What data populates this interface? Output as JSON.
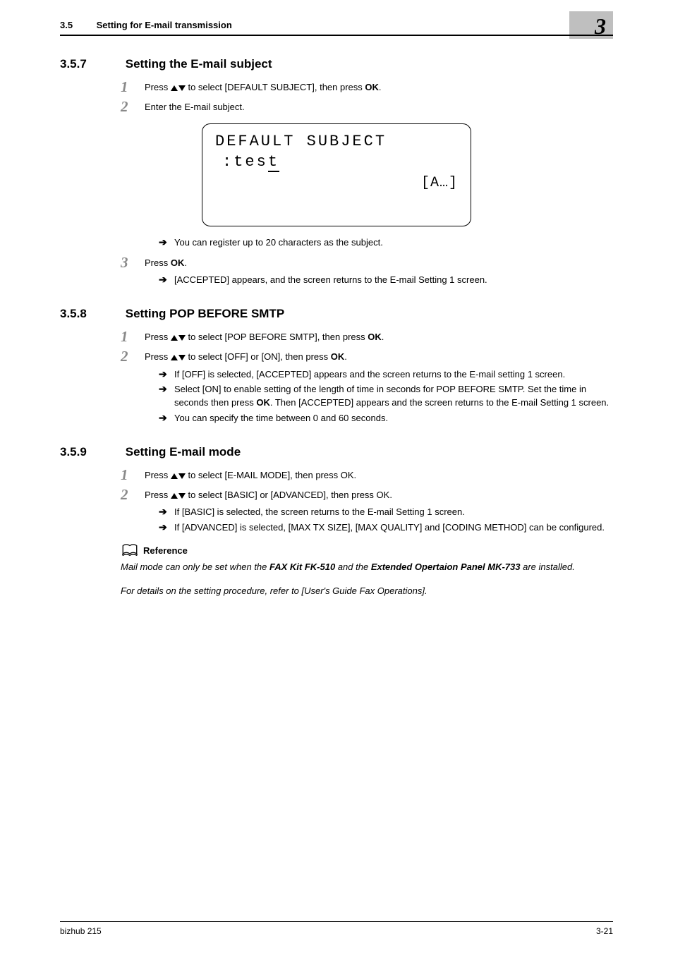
{
  "header": {
    "section_number": "3.5",
    "section_title": "Setting for E-mail transmission",
    "chapter_number": "3"
  },
  "sections": {
    "s357": {
      "num": "3.5.7",
      "title": "Setting the E-mail subject"
    },
    "s358": {
      "num": "3.5.8",
      "title": "Setting POP BEFORE SMTP"
    },
    "s359": {
      "num": "3.5.9",
      "title": "Setting E-mail mode"
    }
  },
  "steps": {
    "s357_1_pre": "Press ",
    "s357_1_post": " to select [DEFAULT SUBJECT], then press ",
    "s357_1_key": "OK",
    "s357_1_end": ".",
    "s357_2": "Enter the E-mail subject.",
    "s357_note1": "You can register up to 20 characters as the subject.",
    "s357_3_pre": "Press ",
    "s357_3_key": "OK",
    "s357_3_end": ".",
    "s357_note2": "[ACCEPTED] appears, and the screen returns to the E-mail Setting 1 screen.",
    "s358_1_pre": "Press ",
    "s358_1_post": " to select [POP BEFORE SMTP], then press ",
    "s358_1_key": "OK",
    "s358_1_end": ".",
    "s358_2_pre": "Press ",
    "s358_2_post": " to select [OFF] or [ON], then press ",
    "s358_2_key": "OK",
    "s358_2_end": ".",
    "s358_note1": "If [OFF] is selected, [ACCEPTED] appears and the screen returns to the E-mail setting 1 screen.",
    "s358_note2_a": "Select [ON] to enable setting of the length of time in seconds for POP BEFORE SMTP. Set the time in seconds then press ",
    "s358_note2_key": "OK",
    "s358_note2_b": ". Then [ACCEPTED] appears and the screen returns to the E-mail Setting 1 screen.",
    "s358_note3": "You can specify the time between 0 and 60 seconds.",
    "s359_1_pre": "Press ",
    "s359_1_post": " to select [E-MAIL MODE], then press OK.",
    "s359_2_pre": "Press ",
    "s359_2_post": " to select [BASIC] or [ADVANCED], then press OK.",
    "s359_note1": "If [BASIC] is selected, the screen returns to the E-mail Setting 1 screen.",
    "s359_note2": "If [ADVANCED] is selected, [MAX TX SIZE], [MAX QUALITY] and [CODING METHOD] can be configured."
  },
  "lcd": {
    "line1": "DEFAULT SUBJECT",
    "line2_prefix": ":tes",
    "line2_cursor": "t",
    "line3": "[A…]"
  },
  "reference": {
    "heading": "Reference",
    "body_a": "Mail mode can only be set when the ",
    "body_kit1": "FAX Kit FK-510",
    "body_mid": " and the ",
    "body_kit2": "Extended Opertaion Panel MK-733",
    "body_b": " are installed.",
    "body_c": "For details on the setting procedure, refer to [User's Guide Fax Operations]."
  },
  "footer": {
    "left": "bizhub 215",
    "right": "3-21"
  },
  "nums": {
    "one": "1",
    "two": "2",
    "three": "3"
  },
  "arrow": "➔"
}
